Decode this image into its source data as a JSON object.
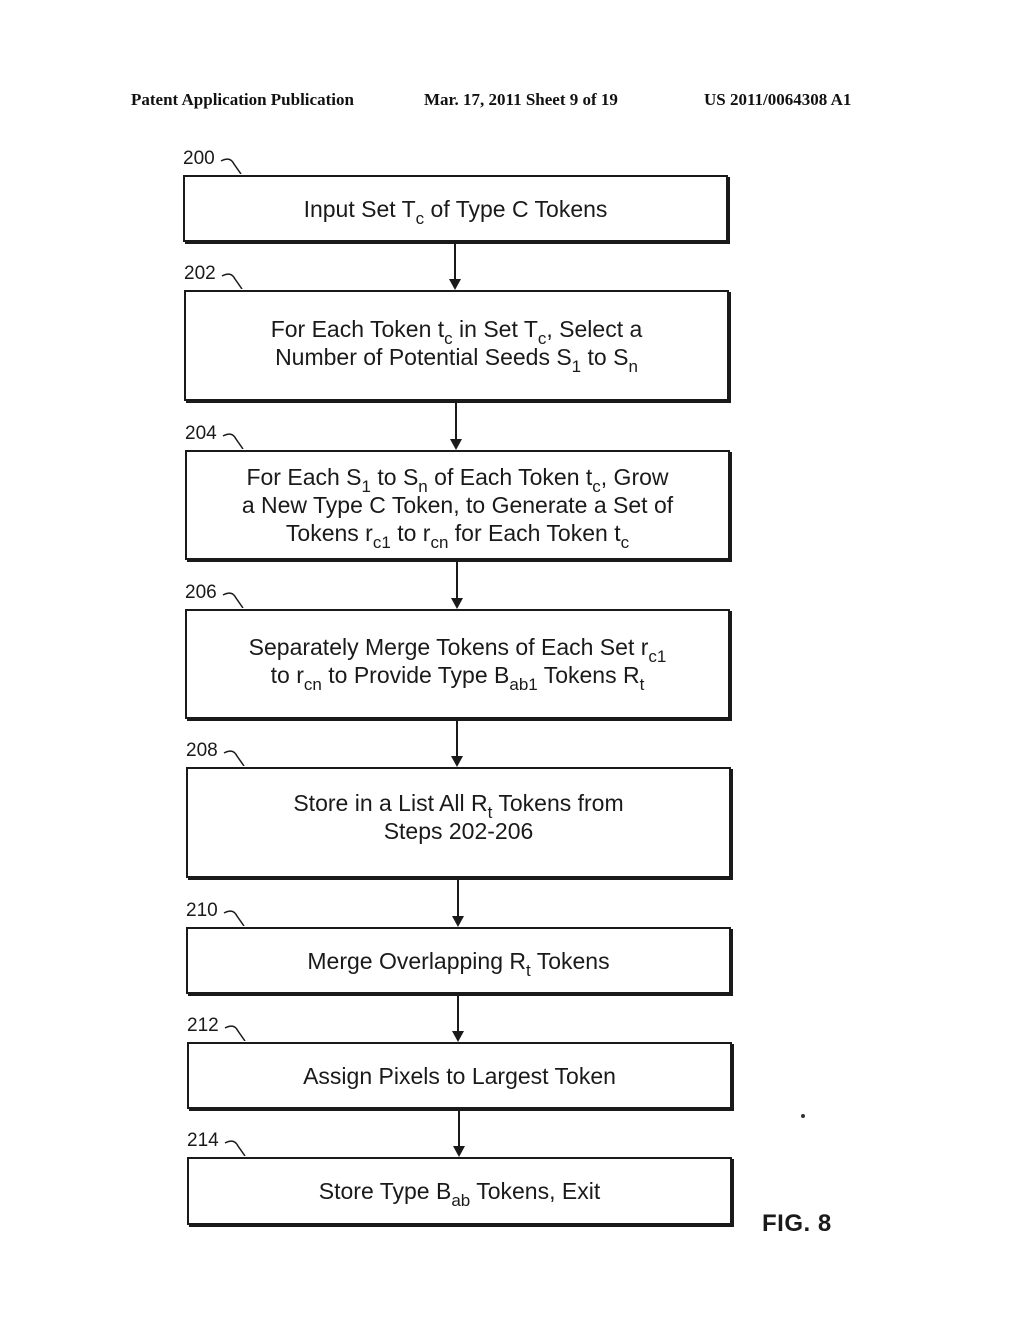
{
  "header": {
    "left": "Patent Application Publication",
    "middle": "Mar. 17, 2011  Sheet 9 of 19",
    "right": "US 2011/0064308 A1"
  },
  "steps": [
    {
      "ref": "200",
      "lines": [
        [
          {
            "t": "Input Set T"
          },
          {
            "sub": "c"
          },
          {
            "t": " of Type C Tokens"
          }
        ]
      ]
    },
    {
      "ref": "202",
      "lines": [
        [
          {
            "t": "For Each Token t"
          },
          {
            "sub": "c"
          },
          {
            "t": " in Set T"
          },
          {
            "sub": "c"
          },
          {
            "t": ", Select a"
          }
        ],
        [
          {
            "t": "Number of Potential Seeds S"
          },
          {
            "sub": "1"
          },
          {
            "t": " to S"
          },
          {
            "sub": "n"
          }
        ]
      ]
    },
    {
      "ref": "204",
      "lines": [
        [
          {
            "t": "For Each S"
          },
          {
            "sub": "1"
          },
          {
            "t": " to S"
          },
          {
            "sub": "n"
          },
          {
            "t": " of Each Token t"
          },
          {
            "sub": "c"
          },
          {
            "t": ", Grow"
          }
        ],
        [
          {
            "t": "a New Type C Token, to Generate a Set of"
          }
        ],
        [
          {
            "t": "Tokens r"
          },
          {
            "sub": "c1"
          },
          {
            "t": " to r"
          },
          {
            "sub": "cn"
          },
          {
            "t": " for Each Token t"
          },
          {
            "sub": "c"
          }
        ]
      ]
    },
    {
      "ref": "206",
      "lines": [
        [
          {
            "t": "Separately Merge Tokens of Each Set r"
          },
          {
            "sub": "c1"
          }
        ],
        [
          {
            "t": "to r"
          },
          {
            "sub": "cn"
          },
          {
            "t": " to Provide Type B"
          },
          {
            "sub": "ab1"
          },
          {
            "t": " Tokens R"
          },
          {
            "sub": "t"
          }
        ]
      ]
    },
    {
      "ref": "208",
      "lines": [
        [
          {
            "t": "Store in a List All R"
          },
          {
            "sub": "t"
          },
          {
            "t": " Tokens from"
          }
        ],
        [
          {
            "t": "Steps 202-206"
          }
        ]
      ]
    },
    {
      "ref": "210",
      "lines": [
        [
          {
            "t": "Merge Overlapping R"
          },
          {
            "sub": "t"
          },
          {
            "t": " Tokens"
          }
        ]
      ]
    },
    {
      "ref": "212",
      "lines": [
        [
          {
            "t": "Assign Pixels to Largest Token"
          }
        ]
      ]
    },
    {
      "ref": "214",
      "lines": [
        [
          {
            "t": "Store Type B"
          },
          {
            "sub": "ab"
          },
          {
            "t": " Tokens, Exit"
          }
        ]
      ]
    }
  ],
  "figure_label": "FIG. 8"
}
